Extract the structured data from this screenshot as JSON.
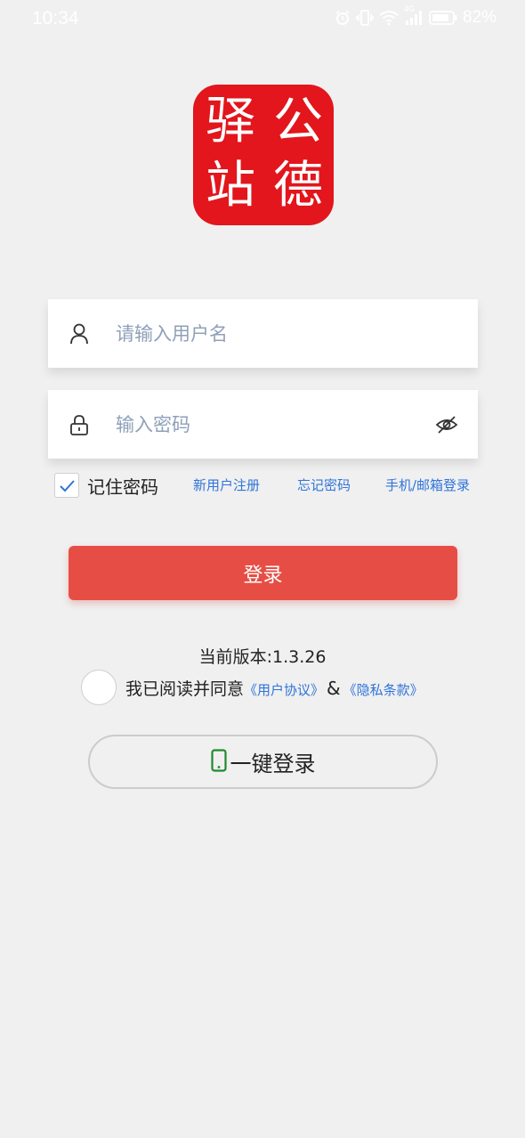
{
  "status_bar": {
    "time": "10:34",
    "network": "4G",
    "battery": "82%"
  },
  "logo": {
    "chars": [
      "公",
      "德",
      "驿",
      "站"
    ],
    "color": "#e2161c"
  },
  "form": {
    "username_placeholder": "请输入用户名",
    "password_placeholder": "输入密码"
  },
  "options": {
    "remember_label": "记住密码",
    "register_link": "新用户注册",
    "forgot_link": "忘记密码",
    "phone_email_link": "手机/邮箱登录"
  },
  "login_button": {
    "label": "登录",
    "color": "#e64e45"
  },
  "version": "当前版本:1.3.26",
  "agreement": {
    "text": "我已阅读并同意",
    "user_agreement": "《用户协议》",
    "amp": "&",
    "privacy": "《隐私条款》"
  },
  "one_click_login": {
    "label": "一键登录",
    "icon_color": "#1e8a2e"
  },
  "icons": {
    "user": "user-icon",
    "lock": "lock-icon",
    "eye": "eye-off-icon",
    "phone": "phone-icon",
    "check": "check-icon"
  }
}
